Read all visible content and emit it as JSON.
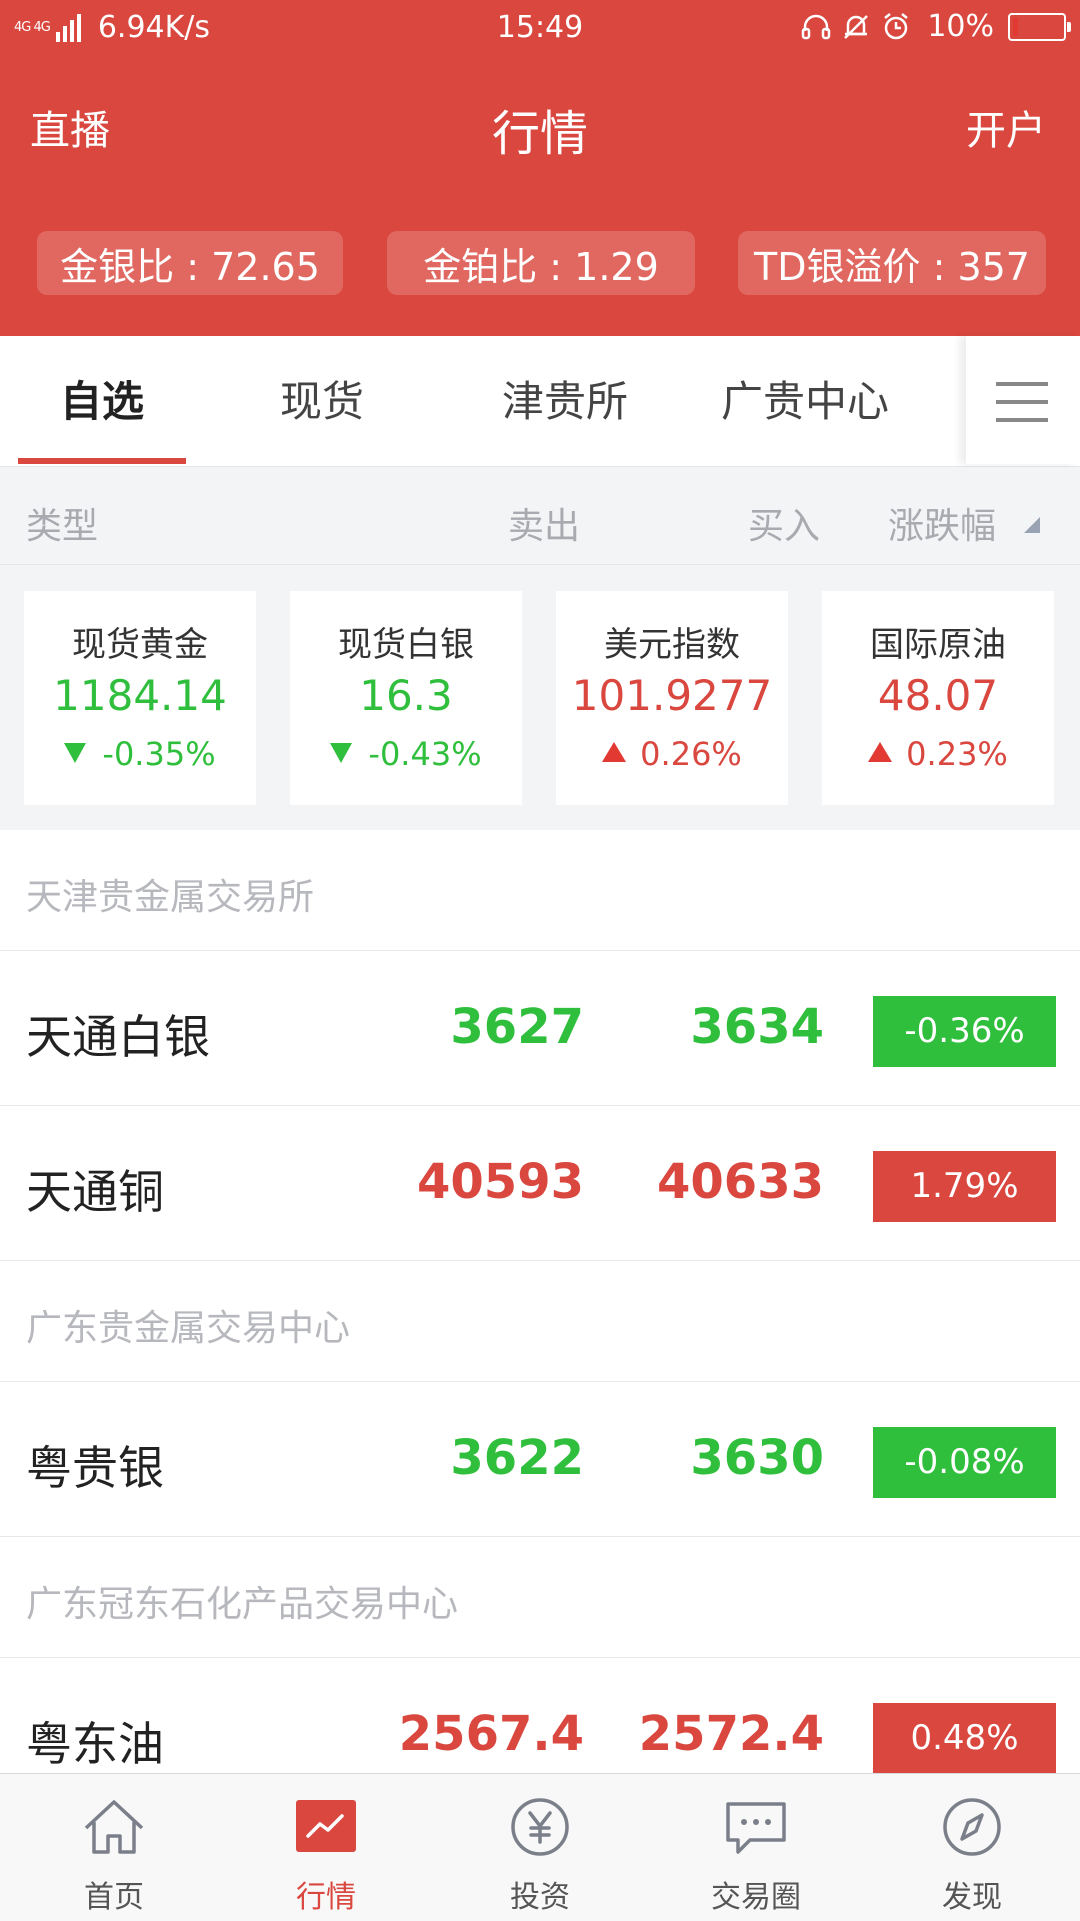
{
  "status_bar": {
    "network": "4G 4G",
    "speed": "6.94K/s",
    "time": "15:49",
    "battery": "10%",
    "battery_level": 0.1,
    "icons": [
      "headset-icon",
      "bell-off-icon",
      "alarm-icon"
    ]
  },
  "nav": {
    "left": "直播",
    "title": "行情",
    "right": "开户"
  },
  "ratios": [
    {
      "text": "金银比 : 72.65"
    },
    {
      "text": "金铂比 : 1.29"
    },
    {
      "text": "TD银溢价 : 357"
    }
  ],
  "tabs": [
    {
      "label": "自选",
      "active": true
    },
    {
      "label": "现货",
      "active": false
    },
    {
      "label": "津贵所",
      "active": false
    },
    {
      "label": "广贵中心",
      "active": false
    }
  ],
  "columns": {
    "type": "类型",
    "sell": "卖出",
    "buy": "买入",
    "change": "涨跌幅"
  },
  "indices": [
    {
      "name": "现货黄金",
      "price": "1184.14",
      "change": "-0.35%",
      "direction": "down"
    },
    {
      "name": "现货白银",
      "price": "16.3",
      "change": "-0.43%",
      "direction": "down"
    },
    {
      "name": "美元指数",
      "price": "101.9277",
      "change": "0.26%",
      "direction": "up"
    },
    {
      "name": "国际原油",
      "price": "48.07",
      "change": "0.23%",
      "direction": "up"
    }
  ],
  "sections": [
    {
      "title": "天津贵金属交易所",
      "rows": [
        {
          "name": "天通白银",
          "sell": "3627",
          "buy": "3634",
          "change": "-0.36%",
          "direction": "down"
        },
        {
          "name": "天通铜",
          "sell": "40593",
          "buy": "40633",
          "change": "1.79%",
          "direction": "up"
        }
      ]
    },
    {
      "title": "广东贵金属交易中心",
      "rows": [
        {
          "name": "粤贵银",
          "sell": "3622",
          "buy": "3630",
          "change": "-0.08%",
          "direction": "down"
        }
      ]
    },
    {
      "title": "广东冠东石化产品交易中心",
      "rows": [
        {
          "name": "粤东油",
          "sell": "2567.4",
          "buy": "2572.4",
          "change": "0.48%",
          "direction": "up"
        }
      ]
    }
  ],
  "bottom_nav": [
    {
      "label": "首页",
      "icon": "home-icon",
      "active": false
    },
    {
      "label": "行情",
      "icon": "market-chart-icon",
      "active": true
    },
    {
      "label": "投资",
      "icon": "yen-coin-icon",
      "active": false
    },
    {
      "label": "交易圈",
      "icon": "chat-bubble-icon",
      "active": false
    },
    {
      "label": "发现",
      "icon": "compass-icon",
      "active": false
    }
  ],
  "colors": {
    "brand_red": "#d9473f",
    "up_red": "#d9473f",
    "down_green": "#2fbf3c"
  }
}
